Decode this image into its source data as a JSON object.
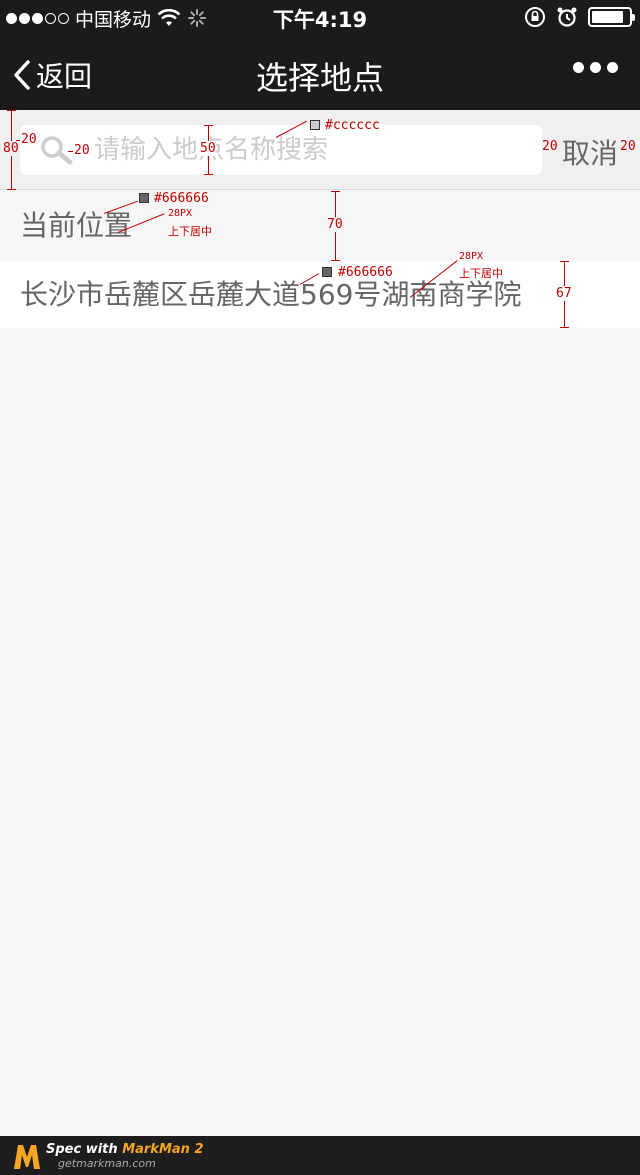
{
  "status_bar": {
    "carrier": "中国移动",
    "time": "下午4:19",
    "battery_level": 0.85
  },
  "nav": {
    "back_label": "返回",
    "title": "选择地点"
  },
  "search": {
    "placeholder": "请输入地点名称搜索",
    "cancel_label": "取消"
  },
  "current_location": {
    "label": "当前位置",
    "address": "长沙市岳麓区岳麓大道569号湖南商学院"
  },
  "annotations": {
    "search_height": "80",
    "left_padding": "20",
    "icon_gap": "20",
    "box_height": "50",
    "placeholder_color": "#cccccc",
    "right_padding": "20",
    "label_color": "#666666",
    "label_size": "28PX",
    "label_align": "上下居中",
    "section_height": "70",
    "address_color": "#666666",
    "address_size": "28PX",
    "address_align": "上下居中",
    "row_height": "67"
  },
  "footer": {
    "title_prefix": "Spec with ",
    "title_brand": "MarkMan 2",
    "site": "getmarkman.com"
  }
}
